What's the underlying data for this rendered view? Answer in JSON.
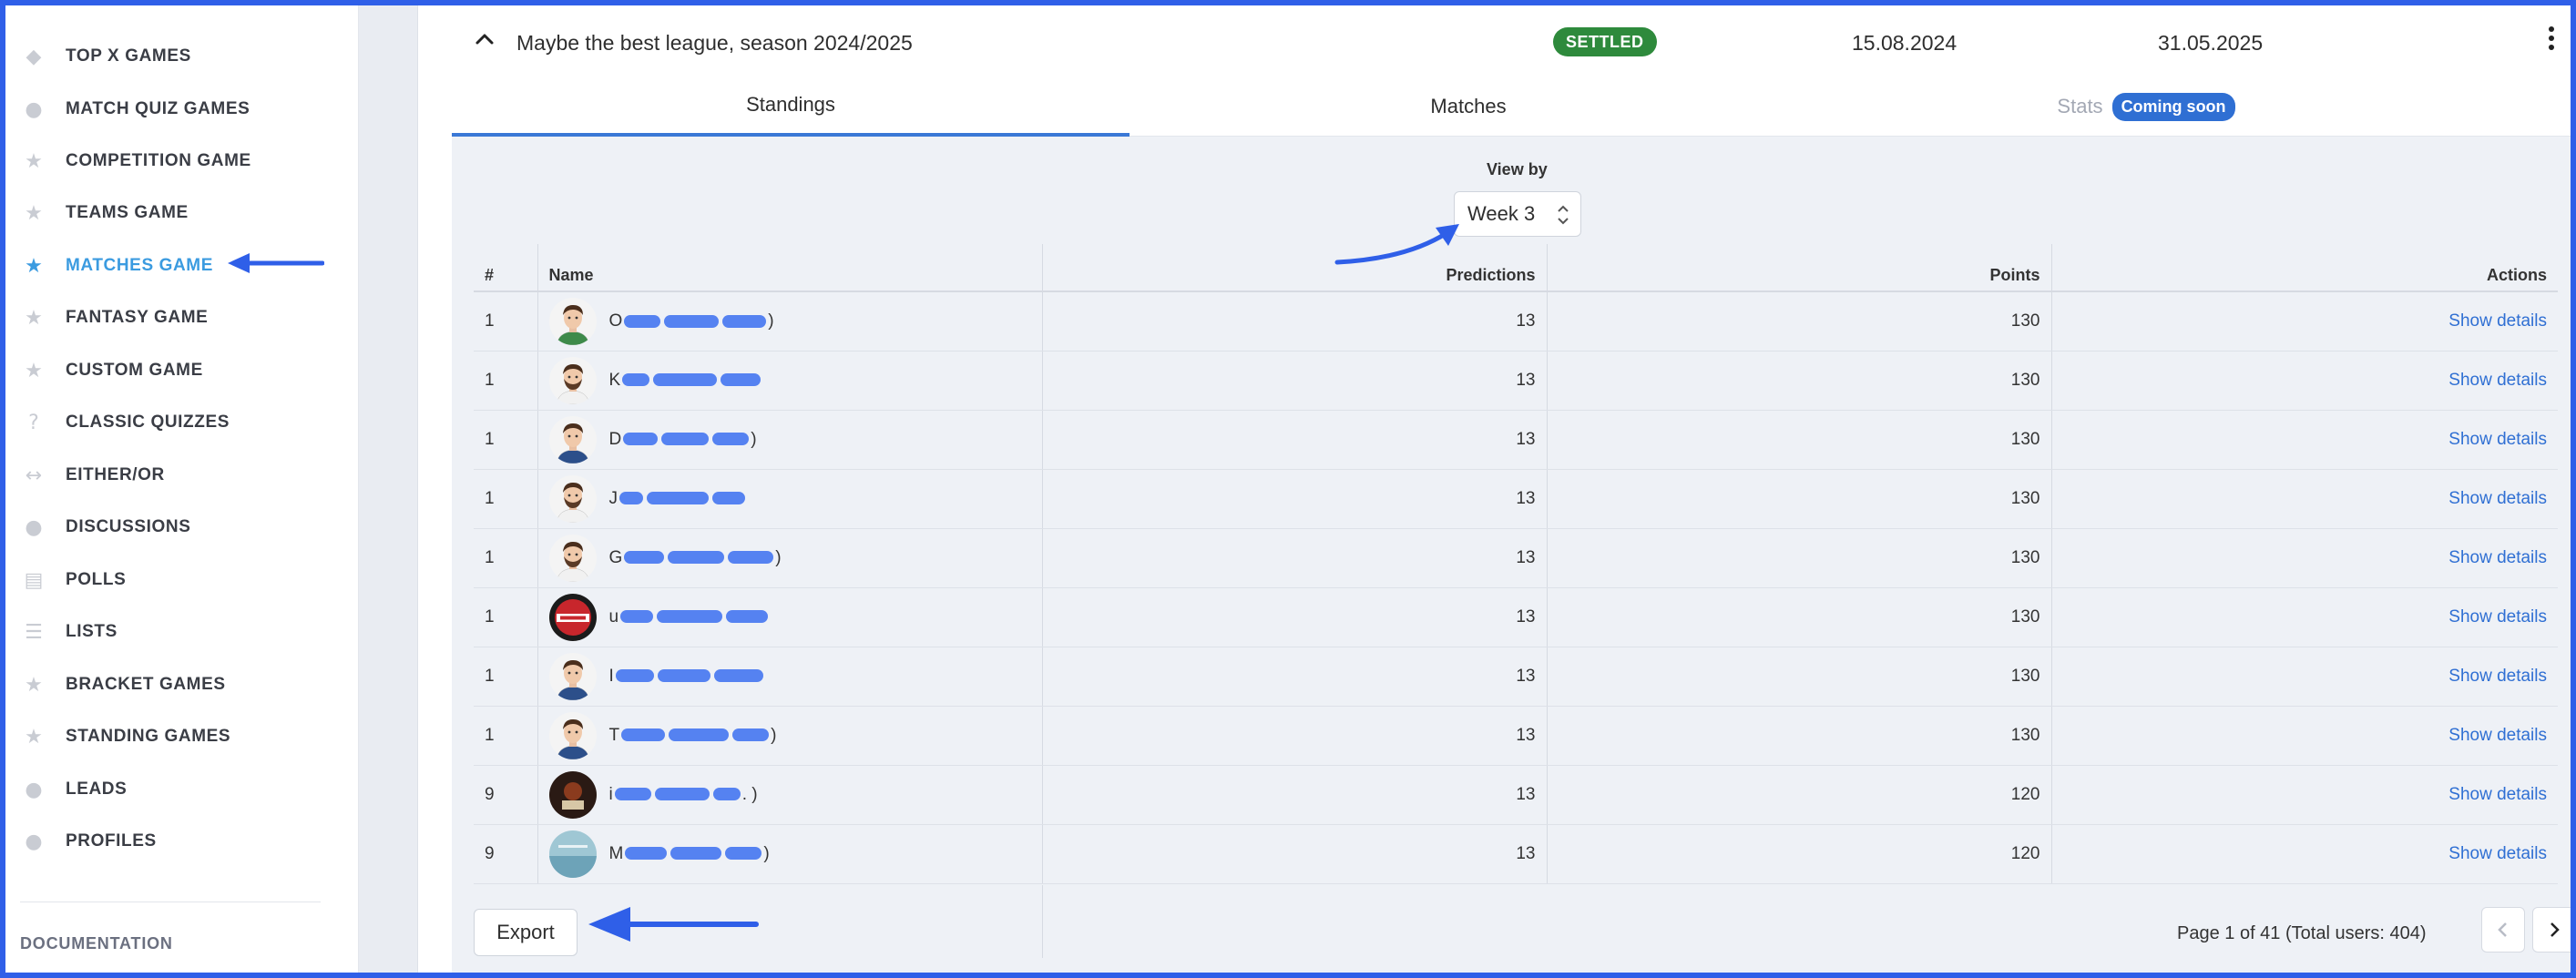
{
  "sidebar": {
    "items": [
      {
        "label": "TOP X GAMES",
        "icon": "diamond-icon"
      },
      {
        "label": "MATCH QUIZ GAMES",
        "icon": "chat-bubbles-icon"
      },
      {
        "label": "COMPETITION GAME",
        "icon": "trophy-icon"
      },
      {
        "label": "TEAMS GAME",
        "icon": "trophy-icon"
      },
      {
        "label": "MATCHES GAME",
        "icon": "trophy-icon",
        "active": true
      },
      {
        "label": "FANTASY GAME",
        "icon": "trophy-icon"
      },
      {
        "label": "CUSTOM GAME",
        "icon": "trophy-icon"
      },
      {
        "label": "CLASSIC QUIZZES",
        "icon": "question-icon"
      },
      {
        "label": "EITHER/OR",
        "icon": "arrows-horizontal-icon"
      },
      {
        "label": "DISCUSSIONS",
        "icon": "chat-bubbles-icon"
      },
      {
        "label": "POLLS",
        "icon": "bar-chart-icon"
      },
      {
        "label": "LISTS",
        "icon": "list-icon"
      },
      {
        "label": "BRACKET GAMES",
        "icon": "trophy-icon"
      },
      {
        "label": "STANDING GAMES",
        "icon": "trophy-icon"
      },
      {
        "label": "LEADS",
        "icon": "people-icon"
      },
      {
        "label": "PROFILES",
        "icon": "people-icon"
      }
    ],
    "documentation": "DOCUMENTATION"
  },
  "league": {
    "title": "Maybe the best league, season 2024/2025",
    "status": "SETTLED",
    "start_date": "15.08.2024",
    "end_date": "31.05.2025"
  },
  "tabs": {
    "standings": "Standings",
    "matches": "Matches",
    "stats": "Stats",
    "stats_badge": "Coming soon"
  },
  "view_by": {
    "label": "View by",
    "selected": "Week 3"
  },
  "table": {
    "headers": {
      "rank": "#",
      "name": "Name",
      "predictions": "Predictions",
      "points": "Points",
      "actions": "Actions"
    },
    "rows": [
      {
        "rank": "1",
        "name_start": "O",
        "name_end": ")",
        "predictions": "13",
        "points": "130",
        "action": "Show details",
        "avatar": "green-shirt"
      },
      {
        "rank": "1",
        "name_start": "K",
        "name_end": "",
        "predictions": "13",
        "points": "130",
        "action": "Show details",
        "avatar": "white-shirt-beard"
      },
      {
        "rank": "1",
        "name_start": "D",
        "name_end": ")",
        "predictions": "13",
        "points": "130",
        "action": "Show details",
        "avatar": "blue-shirt"
      },
      {
        "rank": "1",
        "name_start": "J",
        "name_end": "",
        "predictions": "13",
        "points": "130",
        "action": "Show details",
        "avatar": "white-shirt-beard"
      },
      {
        "rank": "1",
        "name_start": "G",
        "name_end": ")",
        "predictions": "13",
        "points": "130",
        "action": "Show details",
        "avatar": "white-shirt-beard"
      },
      {
        "rank": "1",
        "name_start": "u",
        "name_end": "",
        "predictions": "13",
        "points": "130",
        "action": "Show details",
        "avatar": "red-logo"
      },
      {
        "rank": "1",
        "name_start": "I",
        "name_end": "",
        "predictions": "13",
        "points": "130",
        "action": "Show details",
        "avatar": "blue-shirt"
      },
      {
        "rank": "1",
        "name_start": "T",
        "name_end": ")",
        "predictions": "13",
        "points": "130",
        "action": "Show details",
        "avatar": "blue-shirt"
      },
      {
        "rank": "9",
        "name_start": "i",
        "name_end": ". )",
        "predictions": "13",
        "points": "120",
        "action": "Show details",
        "avatar": "dark-photo"
      },
      {
        "rank": "9",
        "name_start": "M",
        "name_end": ")",
        "predictions": "13",
        "points": "120",
        "action": "Show details",
        "avatar": "sea-photo"
      }
    ]
  },
  "footer": {
    "export_label": "Export",
    "pagination": "Page 1 of 41 (Total users: 404)"
  },
  "colors": {
    "accent": "#3a78d6",
    "settled": "#2e8a3c",
    "annotation_arrow": "#2f5fe8"
  }
}
